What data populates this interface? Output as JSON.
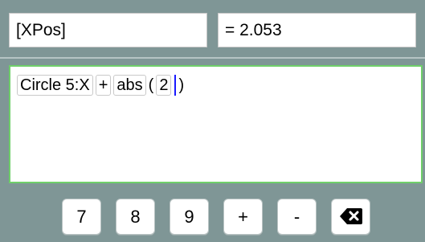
{
  "top": {
    "name": "[XPos]",
    "value": "= 2.053"
  },
  "editor": {
    "tokens": [
      "Circle 5:X",
      "+",
      "abs",
      "(",
      "2",
      ")"
    ]
  },
  "keypad": {
    "keys": [
      "7",
      "8",
      "9",
      "+",
      "-"
    ],
    "backspace_icon": "backspace-icon"
  },
  "colors": {
    "background": "#7f9696",
    "editor_border": "#6fcf6a",
    "caret": "#1a1aff"
  }
}
